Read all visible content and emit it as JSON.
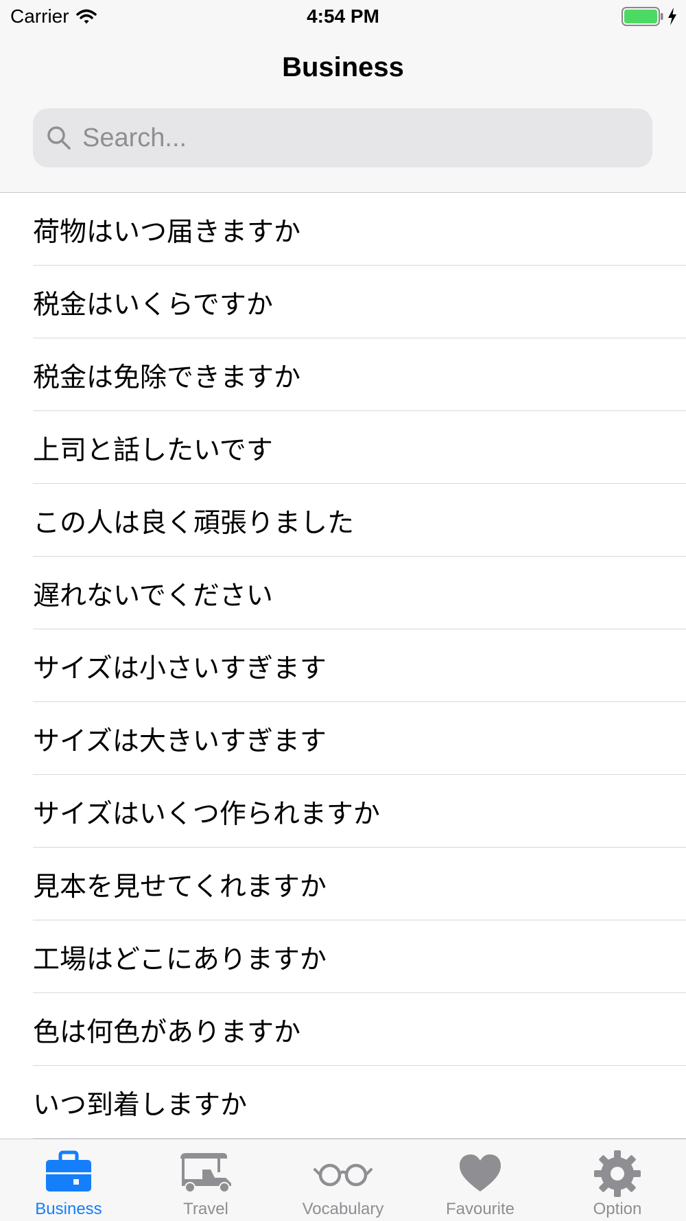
{
  "status_bar": {
    "carrier": "Carrier",
    "time": "4:54 PM"
  },
  "nav": {
    "title": "Business"
  },
  "search": {
    "placeholder": "Search...",
    "value": ""
  },
  "phrases": [
    "荷物はいつ届きますか",
    "税金はいくらですか",
    "税金は免除できますか",
    "上司と話したいです",
    "この人は良く頑張りました",
    "遅れないでください",
    "サイズは小さいすぎます",
    "サイズは大きいすぎます",
    "サイズはいくつ作られますか",
    "見本を見せてくれますか",
    "工場はどこにありますか",
    "色は何色がありますか",
    "いつ到着しますか"
  ],
  "tabs": [
    {
      "label": "Business",
      "icon": "briefcase-icon",
      "active": true
    },
    {
      "label": "Travel",
      "icon": "tuk-tuk-icon",
      "active": false
    },
    {
      "label": "Vocabulary",
      "icon": "glasses-icon",
      "active": false
    },
    {
      "label": "Favourite",
      "icon": "heart-icon",
      "active": false
    },
    {
      "label": "Option",
      "icon": "gear-icon",
      "active": false
    }
  ],
  "colors": {
    "accent": "#147efb",
    "inactive": "#8e8e93",
    "battery": "#4cd964"
  }
}
